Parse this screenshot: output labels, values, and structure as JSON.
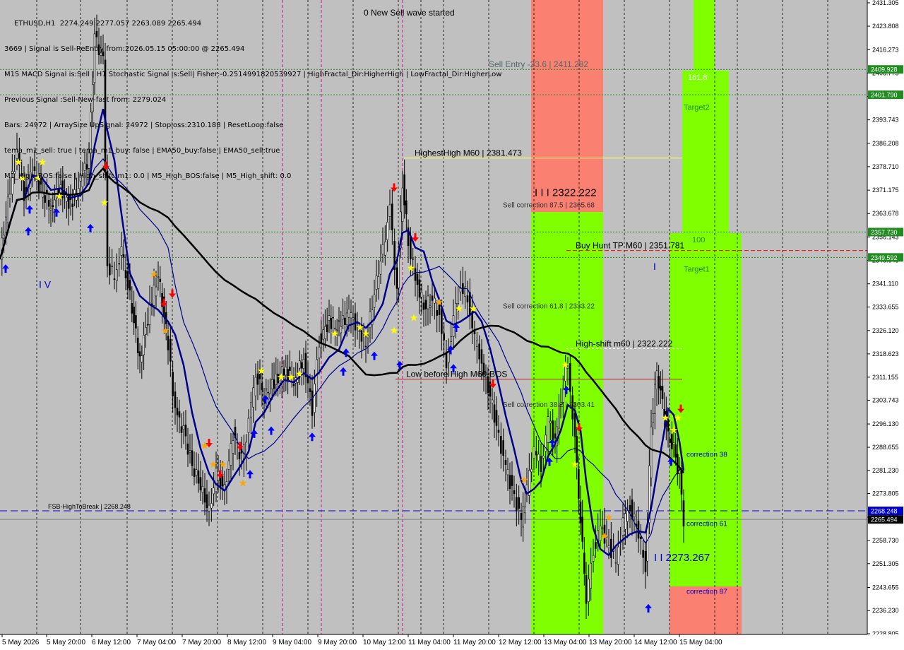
{
  "chart_data": {
    "type": "candlestick",
    "symbol_line": "ETHUSD,H1  2274.249 2277.057 2263.089 2265.494",
    "info_lines": [
      "3669 | Signal is Sell-ReEntry from:2026.05.15 05:00:00 @ 2265.494",
      "M15 MACD Signal is:Sell | H1 Stochastic Signal is:Sell| Fisher:-0.2514991820539927 | HighFractal_Dir:HigherHigh | LowFractal_Dir:HigherLow",
      "Previous Signal :Sell-New-fast from: 2279.024",
      "Bars: 24972 | ArraySize UpSignal: 24972 | Stoploss:2310.188 | ResetLoop:false",
      "tema_m1_sell: true | tema_m1_buy: false | EMA50_buy:false | EMA50_sell:true",
      "M1_High_BOS:false | High_shift_m1: 0.0 | M5_High_BOS:false | M5_High_shift: 0.0"
    ],
    "header_text": "0 New Sell wave started",
    "ylim": [
      2228.8,
      2431.3
    ],
    "y_ticks": [
      2431.305,
      2423.808,
      2416.273,
      2408.775,
      2401.24,
      2393.743,
      2386.208,
      2378.71,
      2371.175,
      2363.678,
      2356.143,
      2348.645,
      2341.11,
      2333.655,
      2326.12,
      2318.623,
      2311.155,
      2303.743,
      2296.13,
      2288.655,
      2281.23,
      2273.805,
      2266.23,
      2258.73,
      2251.305,
      2243.655,
      2236.23,
      2228.805
    ],
    "x_labels": [
      "5 May 2026",
      "5 May 20:00",
      "6 May 12:00",
      "7 May 04:00",
      "7 May 20:00",
      "8 May 12:00",
      "9 May 04:00",
      "9 May 20:00",
      "10 May 12:00",
      "11 May 04:00",
      "11 May 20:00",
      "12 May 12:00",
      "13 May 04:00",
      "13 May 20:00",
      "14 May 12:00",
      "15 May 04:00"
    ],
    "price_tags": [
      {
        "price": 2409.928,
        "text": "2409.928",
        "color": "#228b22"
      },
      {
        "price": 2401.79,
        "text": "2401.790",
        "color": "#228b22"
      },
      {
        "price": 2357.73,
        "text": "2357.730",
        "color": "#228b22"
      },
      {
        "price": 2349.592,
        "text": "2349.592",
        "color": "#228b22"
      },
      {
        "price": 2268.248,
        "text": "2268.248",
        "color": "#0000cd"
      },
      {
        "price": 2265.494,
        "text": "2265.494",
        "color": "#000000"
      }
    ],
    "levels": [
      {
        "price": 2409.928,
        "label": "Sell Entry -23.6 | 2411.282"
      },
      {
        "price": 2381.473,
        "label": "HighestHigh   M60 | 2381.473"
      },
      {
        "price": 2351.781,
        "label": "Buy Hunt TP M60 | 2351.781"
      },
      {
        "price": 2268.248,
        "label": "FSB-HighToBreak | 2268.248"
      },
      {
        "price": 2310.5,
        "label": "Low before High   M60-BOS"
      },
      {
        "price": 2320.3,
        "label": "High-shift m60 | 2322.222"
      }
    ],
    "zone_labels": [
      {
        "text": "I I I 2322.222",
        "price": 2369.3
      },
      {
        "text": "Sell correction 87.5 | 2365.68",
        "price": 2365.6
      },
      {
        "text": "Sell correction 61.8 | 2333.22",
        "price": 2333.2
      },
      {
        "text": "Sell correction 38.2 | 2303.41",
        "price": 2301.6
      },
      {
        "text": "161.8",
        "price": 2406.6
      },
      {
        "text": "Target2",
        "price": 2397.0
      },
      {
        "text": "100",
        "price": 2354.4
      },
      {
        "text": "Target1",
        "price": 2345.0
      },
      {
        "text": "correction 38",
        "price": 2285.6
      },
      {
        "text": "correction 61",
        "price": 2263.4
      },
      {
        "text": "correction 87",
        "price": 2241.6
      },
      {
        "text": "I I 2273.267",
        "price": 2252.2
      },
      {
        "text": "I V",
        "price": 2339.8
      },
      {
        "text": "I",
        "price": 2345.6
      }
    ],
    "close_series": [
      {
        "x": 0,
        "y": 2349
      },
      {
        "x": 14,
        "y": 2372
      },
      {
        "x": 24,
        "y": 2383
      },
      {
        "x": 34,
        "y": 2370
      },
      {
        "x": 46,
        "y": 2378
      },
      {
        "x": 58,
        "y": 2371
      },
      {
        "x": 72,
        "y": 2366
      },
      {
        "x": 86,
        "y": 2372
      },
      {
        "x": 100,
        "y": 2366
      },
      {
        "x": 114,
        "y": 2374
      },
      {
        "x": 126,
        "y": 2382
      },
      {
        "x": 134,
        "y": 2420
      },
      {
        "x": 146,
        "y": 2413
      },
      {
        "x": 152,
        "y": 2346
      },
      {
        "x": 162,
        "y": 2344
      },
      {
        "x": 172,
        "y": 2351
      },
      {
        "x": 184,
        "y": 2337
      },
      {
        "x": 198,
        "y": 2317
      },
      {
        "x": 212,
        "y": 2333
      },
      {
        "x": 224,
        "y": 2344
      },
      {
        "x": 238,
        "y": 2322
      },
      {
        "x": 248,
        "y": 2300
      },
      {
        "x": 260,
        "y": 2294
      },
      {
        "x": 272,
        "y": 2283
      },
      {
        "x": 284,
        "y": 2276
      },
      {
        "x": 296,
        "y": 2268
      },
      {
        "x": 306,
        "y": 2280
      },
      {
        "x": 318,
        "y": 2275
      },
      {
        "x": 330,
        "y": 2293
      },
      {
        "x": 342,
        "y": 2285
      },
      {
        "x": 352,
        "y": 2296
      },
      {
        "x": 362,
        "y": 2313
      },
      {
        "x": 374,
        "y": 2305
      },
      {
        "x": 388,
        "y": 2309
      },
      {
        "x": 402,
        "y": 2314
      },
      {
        "x": 416,
        "y": 2310
      },
      {
        "x": 430,
        "y": 2317
      },
      {
        "x": 442,
        "y": 2301
      },
      {
        "x": 452,
        "y": 2323
      },
      {
        "x": 466,
        "y": 2329
      },
      {
        "x": 480,
        "y": 2327
      },
      {
        "x": 494,
        "y": 2332
      },
      {
        "x": 506,
        "y": 2327
      },
      {
        "x": 518,
        "y": 2322
      },
      {
        "x": 530,
        "y": 2338
      },
      {
        "x": 542,
        "y": 2352
      },
      {
        "x": 552,
        "y": 2365
      },
      {
        "x": 562,
        "y": 2339
      },
      {
        "x": 570,
        "y": 2374
      },
      {
        "x": 578,
        "y": 2355
      },
      {
        "x": 588,
        "y": 2343
      },
      {
        "x": 600,
        "y": 2334
      },
      {
        "x": 612,
        "y": 2336
      },
      {
        "x": 622,
        "y": 2331
      },
      {
        "x": 632,
        "y": 2316
      },
      {
        "x": 642,
        "y": 2329
      },
      {
        "x": 652,
        "y": 2340
      },
      {
        "x": 662,
        "y": 2337
      },
      {
        "x": 672,
        "y": 2323
      },
      {
        "x": 682,
        "y": 2316
      },
      {
        "x": 694,
        "y": 2305
      },
      {
        "x": 706,
        "y": 2292
      },
      {
        "x": 716,
        "y": 2282
      },
      {
        "x": 728,
        "y": 2273
      },
      {
        "x": 738,
        "y": 2265
      },
      {
        "x": 746,
        "y": 2275
      },
      {
        "x": 756,
        "y": 2288
      },
      {
        "x": 766,
        "y": 2283
      },
      {
        "x": 776,
        "y": 2297
      },
      {
        "x": 786,
        "y": 2291
      },
      {
        "x": 794,
        "y": 2305
      },
      {
        "x": 804,
        "y": 2316
      },
      {
        "x": 814,
        "y": 2290
      },
      {
        "x": 822,
        "y": 2265
      },
      {
        "x": 830,
        "y": 2240
      },
      {
        "x": 840,
        "y": 2256
      },
      {
        "x": 850,
        "y": 2263
      },
      {
        "x": 862,
        "y": 2257
      },
      {
        "x": 872,
        "y": 2252
      },
      {
        "x": 882,
        "y": 2264
      },
      {
        "x": 892,
        "y": 2270
      },
      {
        "x": 904,
        "y": 2261
      },
      {
        "x": 914,
        "y": 2250
      },
      {
        "x": 922,
        "y": 2296
      },
      {
        "x": 930,
        "y": 2313
      },
      {
        "x": 938,
        "y": 2303
      },
      {
        "x": 946,
        "y": 2292
      },
      {
        "x": 954,
        "y": 2288
      },
      {
        "x": 962,
        "y": 2279
      },
      {
        "x": 968,
        "y": 2265.5
      }
    ],
    "signal_markers": [
      {
        "x": 8,
        "y": 2346,
        "kind": "up"
      },
      {
        "x": 40,
        "y": 2358,
        "kind": "up"
      },
      {
        "x": 42,
        "y": 2365,
        "kind": "up"
      },
      {
        "x": 80,
        "y": 2364,
        "kind": "up"
      },
      {
        "x": 128,
        "y": 2359,
        "kind": "up"
      },
      {
        "x": 150,
        "y": 2379,
        "kind": "down"
      },
      {
        "x": 232,
        "y": 2335,
        "kind": "down"
      },
      {
        "x": 244,
        "y": 2338,
        "kind": "down"
      },
      {
        "x": 296,
        "y": 2290,
        "kind": "down"
      },
      {
        "x": 312,
        "y": 2280,
        "kind": "down"
      },
      {
        "x": 340,
        "y": 2289,
        "kind": "down"
      },
      {
        "x": 354,
        "y": 2280,
        "kind": "up"
      },
      {
        "x": 360,
        "y": 2293,
        "kind": "up"
      },
      {
        "x": 376,
        "y": 2304,
        "kind": "up"
      },
      {
        "x": 384,
        "y": 2294,
        "kind": "up"
      },
      {
        "x": 442,
        "y": 2292,
        "kind": "up"
      },
      {
        "x": 486,
        "y": 2313,
        "kind": "up"
      },
      {
        "x": 490,
        "y": 2319,
        "kind": "up"
      },
      {
        "x": 530,
        "y": 2318,
        "kind": "up"
      },
      {
        "x": 558,
        "y": 2372,
        "kind": "down"
      },
      {
        "x": 566,
        "y": 2315,
        "kind": "up"
      },
      {
        "x": 588,
        "y": 2356,
        "kind": "down"
      },
      {
        "x": 638,
        "y": 2320,
        "kind": "up"
      },
      {
        "x": 642,
        "y": 2314,
        "kind": "up"
      },
      {
        "x": 646,
        "y": 2327,
        "kind": "up"
      },
      {
        "x": 698,
        "y": 2309,
        "kind": "down"
      },
      {
        "x": 778,
        "y": 2284,
        "kind": "up"
      },
      {
        "x": 782,
        "y": 2290,
        "kind": "up"
      },
      {
        "x": 802,
        "y": 2307,
        "kind": "up"
      },
      {
        "x": 820,
        "y": 2295,
        "kind": "down"
      },
      {
        "x": 918,
        "y": 2237,
        "kind": "up"
      },
      {
        "x": 950,
        "y": 2284,
        "kind": "up"
      },
      {
        "x": 964,
        "y": 2301,
        "kind": "down"
      }
    ],
    "star_markers": [
      {
        "x": 26,
        "y": 2380,
        "kind": "gold"
      },
      {
        "x": 32,
        "y": 2375,
        "kind": "gold"
      },
      {
        "x": 54,
        "y": 2375,
        "kind": "gold"
      },
      {
        "x": 60,
        "y": 2380,
        "kind": "gold"
      },
      {
        "x": 84,
        "y": 2369,
        "kind": "gold"
      },
      {
        "x": 148,
        "y": 2367,
        "kind": "gold"
      },
      {
        "x": 218,
        "y": 2344,
        "kind": "orange"
      },
      {
        "x": 234,
        "y": 2326,
        "kind": "orange"
      },
      {
        "x": 290,
        "y": 2289,
        "kind": "orange"
      },
      {
        "x": 302,
        "y": 2283,
        "kind": "orange"
      },
      {
        "x": 316,
        "y": 2283,
        "kind": "orange"
      },
      {
        "x": 344,
        "y": 2277,
        "kind": "orange"
      },
      {
        "x": 370,
        "y": 2313,
        "kind": "gold"
      },
      {
        "x": 398,
        "y": 2311,
        "kind": "gold"
      },
      {
        "x": 412,
        "y": 2311,
        "kind": "gold"
      },
      {
        "x": 424,
        "y": 2312,
        "kind": "gold"
      },
      {
        "x": 474,
        "y": 2325,
        "kind": "gold"
      },
      {
        "x": 510,
        "y": 2327,
        "kind": "gold"
      },
      {
        "x": 518,
        "y": 2325,
        "kind": "gold"
      },
      {
        "x": 558,
        "y": 2326,
        "kind": "gold"
      },
      {
        "x": 582,
        "y": 2346,
        "kind": "gold"
      },
      {
        "x": 586,
        "y": 2330,
        "kind": "gold"
      },
      {
        "x": 622,
        "y": 2335,
        "kind": "orange"
      },
      {
        "x": 650,
        "y": 2333,
        "kind": "gold"
      },
      {
        "x": 670,
        "y": 2333,
        "kind": "gold"
      },
      {
        "x": 742,
        "y": 2278,
        "kind": "orange"
      },
      {
        "x": 800,
        "y": 2315,
        "kind": "gold"
      },
      {
        "x": 814,
        "y": 2283,
        "kind": "gold"
      },
      {
        "x": 862,
        "y": 2266,
        "kind": "orange"
      },
      {
        "x": 856,
        "y": 2260,
        "kind": "orange"
      },
      {
        "x": 942,
        "y": 2298,
        "kind": "gold"
      },
      {
        "x": 954,
        "y": 2294,
        "kind": "gold"
      },
      {
        "x": 960,
        "y": 2298,
        "kind": "gold"
      }
    ],
    "colors": {
      "background": "#c0c0c0",
      "zone_green": "#7fff00",
      "zone_red": "#fa8072",
      "ma_long": "#000000",
      "ma_fast": "#00008b",
      "up_arrow": "#0000ff",
      "down_arrow": "#ff0000",
      "grid_vertical": "#000000"
    }
  }
}
